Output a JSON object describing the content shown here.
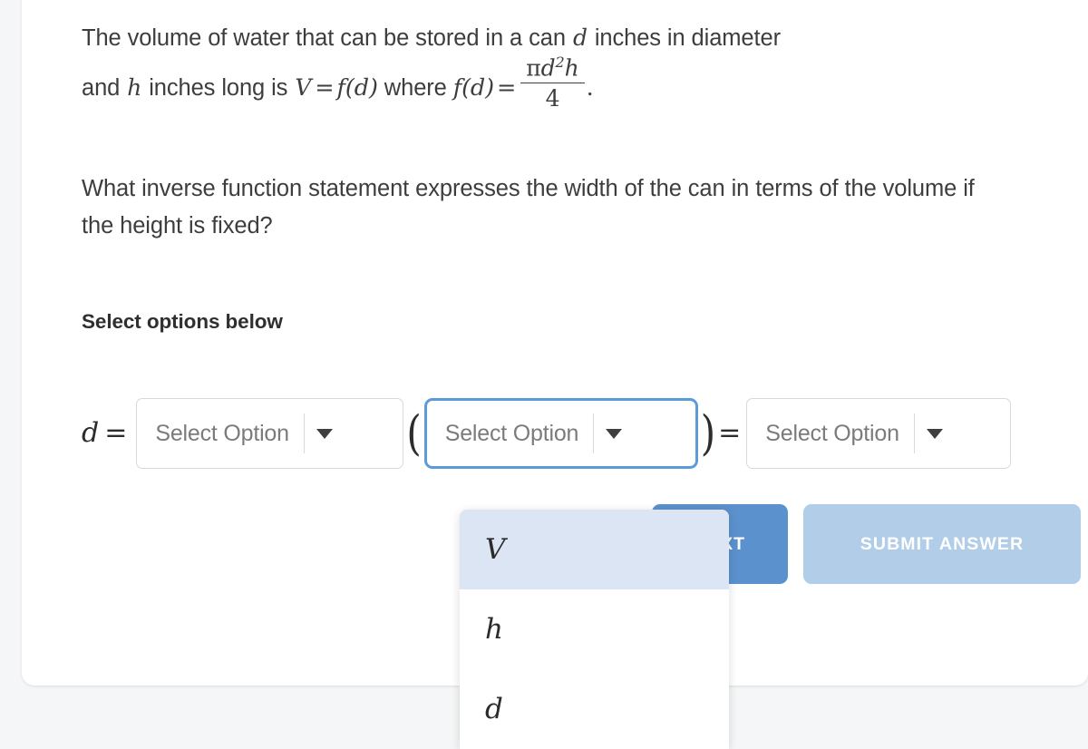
{
  "question": {
    "paragraph1": {
      "t1": "The volume of water that can be stored in a can ",
      "v1": "d",
      "t2": " inches in diameter",
      "t3": "and ",
      "v2": "h",
      "t4": " inches long is ",
      "v3": "V",
      "eq1": "=",
      "fn1": "f(d)",
      "t5": " where ",
      "fn2": "f(d)",
      "eq2": "=",
      "frac_num_pi": "π",
      "frac_num_d": "d",
      "frac_num_sup": "2",
      "frac_num_h": "h",
      "frac_den": "4",
      "period": "."
    },
    "paragraph2": "What inverse function statement expresses the width of the can in terms of the volume if the height is fixed?",
    "select_heading": "Select options below"
  },
  "answer_row": {
    "lead_variable": "d",
    "lead_equals": "=",
    "open_paren": "(",
    "close_paren": ")",
    "mid_equals": "=",
    "dropdown1": {
      "value": "Select Option",
      "arrow": "chevron-down-icon"
    },
    "dropdown2": {
      "value": "Select Option",
      "arrow": "chevron-down-icon",
      "focused": true,
      "focus_color": "#5a9bd8"
    },
    "dropdown3": {
      "value": "Select Option",
      "arrow": "chevron-down-icon"
    }
  },
  "dropdown_menu": {
    "open_for": "dropdown2",
    "highlight_color": "#dce5f3",
    "options": [
      {
        "label": "V",
        "selected": true
      },
      {
        "label": "h",
        "selected": false
      },
      {
        "label": "d",
        "selected": false
      }
    ]
  },
  "buttons": {
    "next": {
      "label": "NEXT",
      "color": "#5b91cc"
    },
    "submit": {
      "label": "SUBMIT ANSWER",
      "color": "#b2cde8"
    }
  },
  "colors": {
    "page_background": "#f5f6f7",
    "card_background": "#ffffff",
    "text": "#3d3d3d",
    "placeholder": "#7b7b7b",
    "border": "#d9d9d9"
  }
}
